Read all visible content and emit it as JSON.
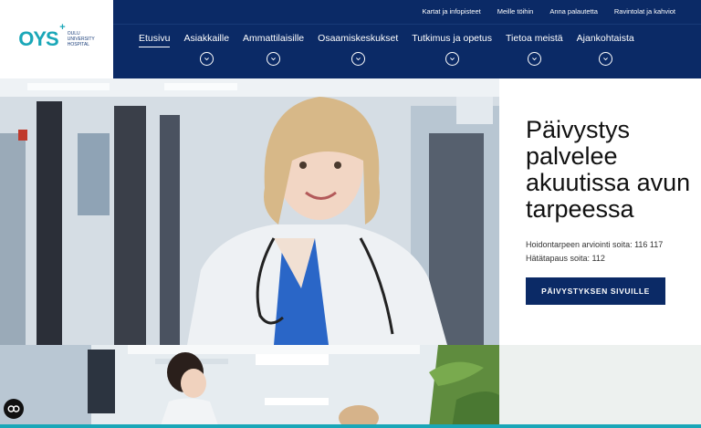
{
  "logo": {
    "mark": "OYS",
    "plus": "+",
    "sub_line1": "OULU",
    "sub_line2": "UNIVERSITY",
    "sub_line3": "HOSPITAL"
  },
  "utility_links": [
    "Kartat ja infopisteet",
    "Meille töihin",
    "Anna palautetta",
    "Ravintolat ja kahviot"
  ],
  "nav": [
    {
      "label": "Etusivu",
      "active": true
    },
    {
      "label": "Asiakkaille"
    },
    {
      "label": "Ammattilaisille"
    },
    {
      "label": "Osaamiskeskukset"
    },
    {
      "label": "Tutkimus ja opetus"
    },
    {
      "label": "Tietoa meistä"
    },
    {
      "label": "Ajankohtaista"
    }
  ],
  "hero": {
    "title_line1": "Päivystys",
    "title_line2": "palvelee",
    "title_line3": "akuutissa avun",
    "title_line4": "tarpeessa",
    "info1": "Hoidontarpeen arviointi soita: 116 117",
    "info2": "Hätätapaus soita: 112",
    "button": "PÄIVYSTYKSEN SIVUILLE"
  },
  "colors": {
    "navy": "#0b2a66",
    "teal": "#1aa7b8"
  },
  "icons": {
    "chevron": "chevron-down-icon",
    "cookie": "cookie-settings-icon"
  }
}
